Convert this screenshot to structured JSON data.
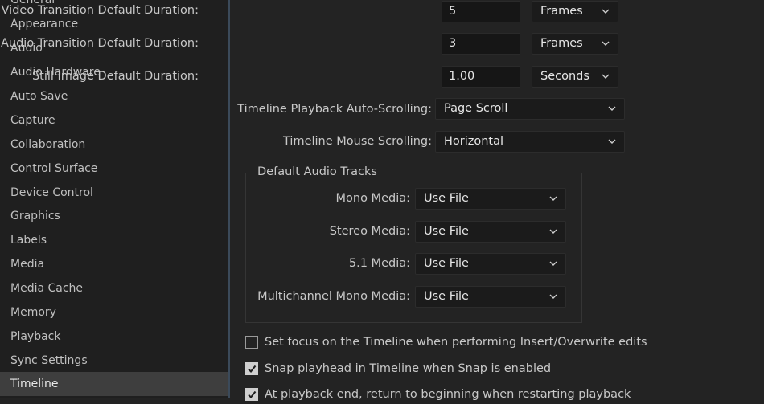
{
  "sidebar": {
    "items": [
      {
        "label": "General"
      },
      {
        "label": "Appearance"
      },
      {
        "label": "Audio"
      },
      {
        "label": "Audio Hardware"
      },
      {
        "label": "Auto Save"
      },
      {
        "label": "Capture"
      },
      {
        "label": "Collaboration"
      },
      {
        "label": "Control Surface"
      },
      {
        "label": "Device Control"
      },
      {
        "label": "Graphics"
      },
      {
        "label": "Labels"
      },
      {
        "label": "Media"
      },
      {
        "label": "Media Cache"
      },
      {
        "label": "Memory"
      },
      {
        "label": "Playback"
      },
      {
        "label": "Sync Settings"
      },
      {
        "label": "Timeline"
      }
    ],
    "selected": "Timeline"
  },
  "settings": {
    "video_transition": {
      "label": "Video Transition Default Duration:",
      "value": "5",
      "unit": "Frames"
    },
    "audio_transition": {
      "label": "Audio Transition Default Duration:",
      "value": "3",
      "unit": "Frames"
    },
    "still_image": {
      "label": "Still Image Default Duration:",
      "value": "1.00",
      "unit": "Seconds"
    },
    "playback_autoscroll": {
      "label": "Timeline Playback Auto-Scrolling:",
      "value": "Page Scroll"
    },
    "mouse_scrolling": {
      "label": "Timeline Mouse Scrolling:",
      "value": "Horizontal"
    }
  },
  "audio_tracks": {
    "title": "Default Audio Tracks",
    "mono": {
      "label": "Mono Media:",
      "value": "Use File"
    },
    "stereo": {
      "label": "Stereo Media:",
      "value": "Use File"
    },
    "five_one": {
      "label": "5.1 Media:",
      "value": "Use File"
    },
    "multichannel": {
      "label": "Multichannel Mono Media:",
      "value": "Use File"
    }
  },
  "checkboxes": {
    "focus_timeline": {
      "label": "Set focus on the Timeline when performing Insert/Overwrite edits",
      "checked": false
    },
    "snap_playhead": {
      "label": "Snap playhead in Timeline when Snap is enabled",
      "checked": true
    },
    "return_beginning": {
      "label": "At playback end, return to beginning when restarting playback",
      "checked": true
    }
  }
}
